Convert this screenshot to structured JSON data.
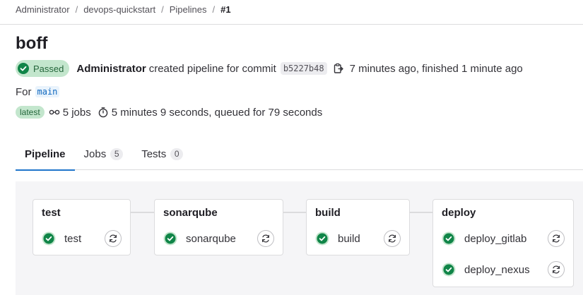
{
  "breadcrumb": [
    "Administrator",
    "devops-quickstart",
    "Pipelines",
    "#1"
  ],
  "page": {
    "title": "boff"
  },
  "status": {
    "badge": "Passed",
    "author": "Administrator",
    "created_text": "created pipeline for commit",
    "commit_sha": "b5227b48",
    "timing": "7 minutes ago, finished 1 minute ago"
  },
  "ref": {
    "prefix": "For",
    "name": "main"
  },
  "meta": {
    "latest_badge": "latest",
    "jobs": "5 jobs",
    "duration": "5 minutes 9 seconds, queued for 79 seconds"
  },
  "tabs": [
    {
      "label": "Pipeline",
      "count": ""
    },
    {
      "label": "Jobs",
      "count": "5"
    },
    {
      "label": "Tests",
      "count": "0"
    }
  ],
  "stages": [
    {
      "name": "test",
      "jobs": [
        {
          "name": "test",
          "status": "passed"
        }
      ]
    },
    {
      "name": "sonarqube",
      "jobs": [
        {
          "name": "sonarqube",
          "status": "passed"
        }
      ]
    },
    {
      "name": "build",
      "jobs": [
        {
          "name": "build",
          "status": "passed"
        }
      ]
    },
    {
      "name": "deploy",
      "jobs": [
        {
          "name": "deploy_gitlab",
          "status": "passed"
        },
        {
          "name": "deploy_nexus",
          "status": "passed"
        }
      ]
    }
  ],
  "colors": {
    "success": "#108548",
    "success_bg": "#c3e6cd",
    "link": "#1f75cb"
  }
}
